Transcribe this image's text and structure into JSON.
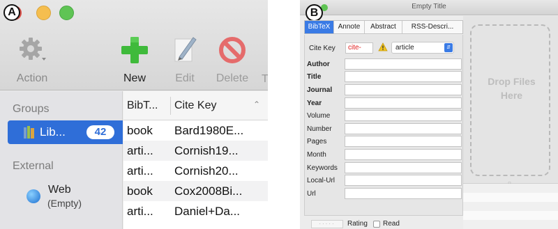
{
  "panel_a": {
    "label": "A",
    "toolbar": {
      "action_label": "Action",
      "new_label": "New",
      "edit_label": "Edit",
      "delete_label": "Delete",
      "overflow_label": "T"
    },
    "sidebar": {
      "groups_header": "Groups",
      "library_name": "Lib...",
      "library_count": "42",
      "external_header": "External",
      "web_name": "Web",
      "web_status": "(Empty)"
    },
    "table": {
      "columns": [
        "BibT...",
        "Cite Key"
      ],
      "rows": [
        {
          "type": "book",
          "key": "Bard1980E..."
        },
        {
          "type": "arti...",
          "key": "Cornish19..."
        },
        {
          "type": "arti...",
          "key": "Cornish20..."
        },
        {
          "type": "book",
          "key": "Cox2008Bi..."
        },
        {
          "type": "arti...",
          "key": "Daniel+Da..."
        }
      ]
    }
  },
  "panel_b": {
    "label": "B",
    "window_title": "Empty Title",
    "tabs": [
      "BibTeX",
      "Annote",
      "Abstract",
      "RSS-Descri..."
    ],
    "cite_key_label": "Cite Key",
    "cite_key_value": "cite-",
    "type_value": "article",
    "fields": [
      {
        "label": "Author",
        "bold": true
      },
      {
        "label": "Title",
        "bold": true
      },
      {
        "label": "Journal",
        "bold": true
      },
      {
        "label": "Year",
        "bold": true
      },
      {
        "label": "Volume",
        "bold": false
      },
      {
        "label": "Number",
        "bold": false
      },
      {
        "label": "Pages",
        "bold": false
      },
      {
        "label": "Month",
        "bold": false
      },
      {
        "label": "Keywords",
        "bold": false
      },
      {
        "label": "Local-Url",
        "bold": false
      },
      {
        "label": "Url",
        "bold": false
      }
    ],
    "rating_label": "Rating",
    "read_label": "Read",
    "drop_text_line1": "Drop Files",
    "drop_text_line2": "Here"
  },
  "colors": {
    "selection_blue": "#2f6ed8",
    "tab_blue": "#3a7be5",
    "new_green": "#3fba3b",
    "delete_red": "#e56b6b",
    "cite_key_red": "#e02020"
  },
  "icons": {
    "action": "gear-icon",
    "new": "plus-icon",
    "edit": "pencil-icon",
    "delete": "prohibit-icon",
    "library": "library-icon",
    "web": "globe-icon",
    "warning": "warning-icon"
  }
}
